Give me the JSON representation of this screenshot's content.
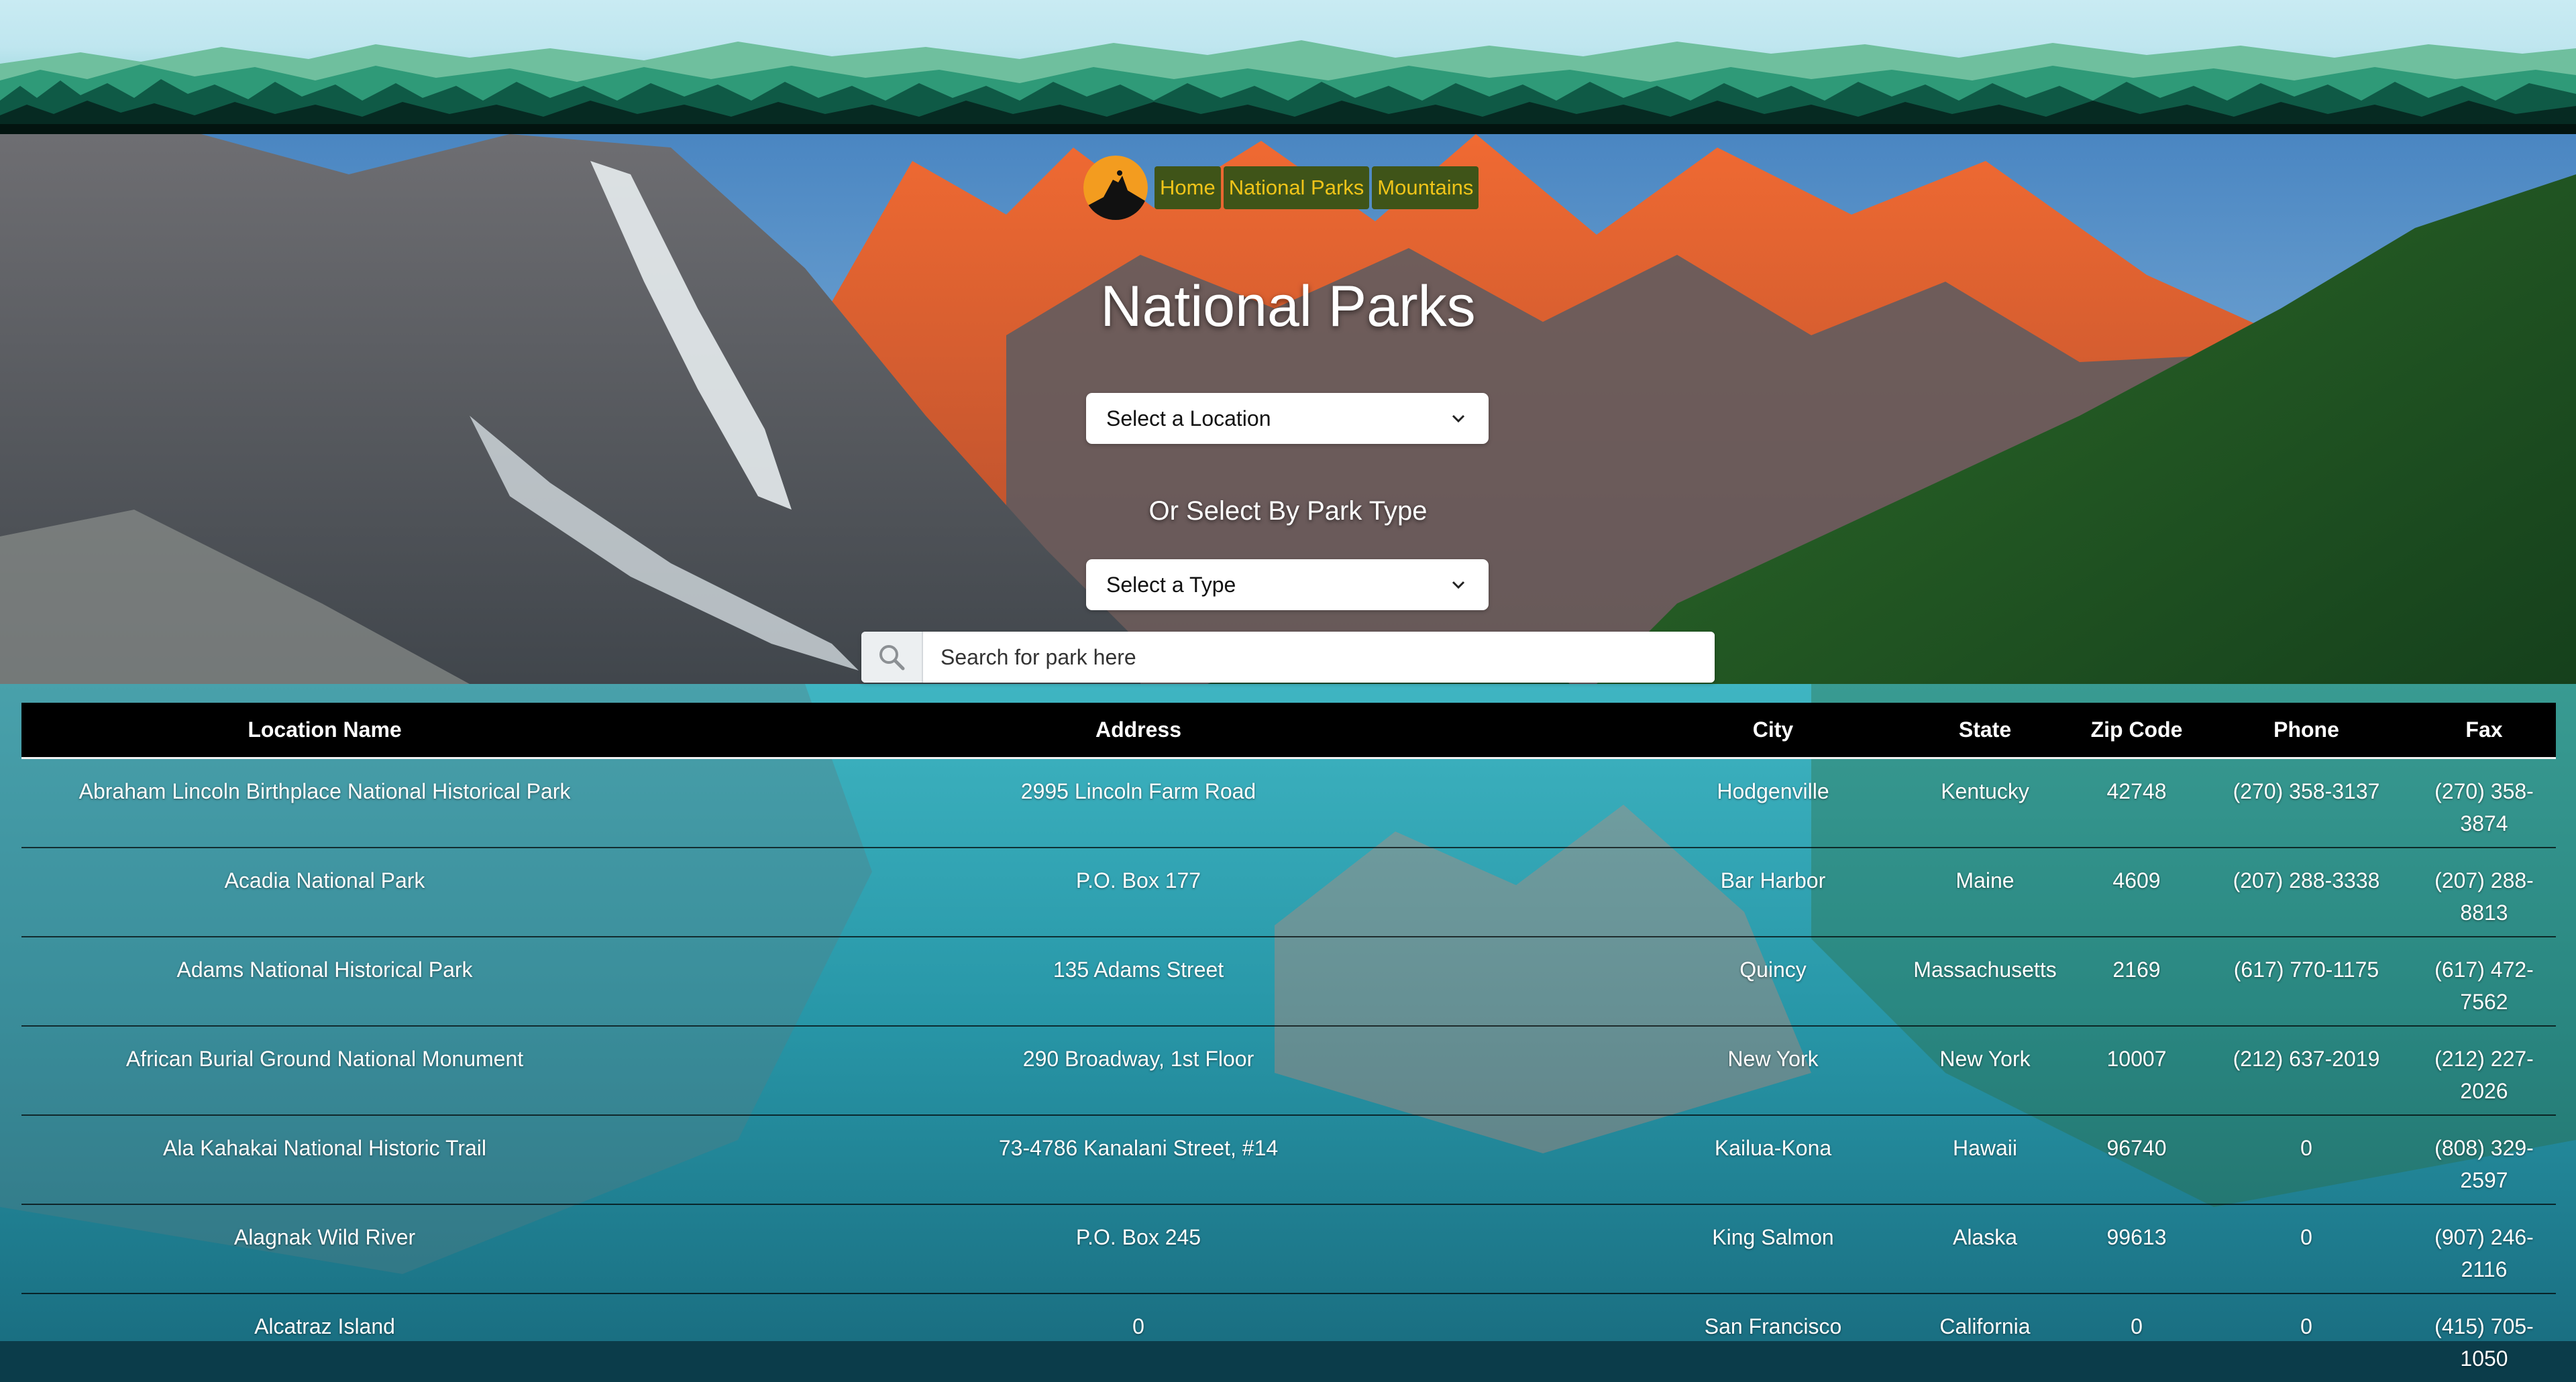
{
  "nav": {
    "logo": "mountain-logo",
    "links": [
      "Home",
      "National Parks",
      "Mountains"
    ]
  },
  "page": {
    "title": "National Parks",
    "location_select": "Select a Location",
    "or_label": "Or Select By Park Type",
    "type_select": "Select a Type",
    "search_placeholder": "Search for park here"
  },
  "table": {
    "headers": [
      "Location Name",
      "Address",
      "City",
      "State",
      "Zip Code",
      "Phone",
      "Fax"
    ],
    "rows": [
      [
        "Abraham Lincoln Birthplace National Historical Park",
        "2995 Lincoln Farm Road",
        "Hodgenville",
        "Kentucky",
        "42748",
        "(270) 358-3137",
        "(270) 358-3874"
      ],
      [
        "Acadia National Park",
        "P.O. Box 177",
        "Bar Harbor",
        "Maine",
        "4609",
        "(207) 288-3338",
        "(207) 288-8813"
      ],
      [
        "Adams National Historical Park",
        "135 Adams Street",
        "Quincy",
        "Massachusetts",
        "2169",
        "(617) 770-1175",
        "(617) 472-7562"
      ],
      [
        "African Burial Ground National Monument",
        "290 Broadway, 1st Floor",
        "New York",
        "New York",
        "10007",
        "(212) 637-2019",
        "(212) 227-2026"
      ],
      [
        "Ala Kahakai National Historic Trail",
        "73-4786 Kanalani Street, #14",
        "Kailua-Kona",
        "Hawaii",
        "96740",
        "0",
        "(808) 329-2597"
      ],
      [
        "Alagnak Wild River",
        "P.O. Box 245",
        "King Salmon",
        "Alaska",
        "99613",
        "0",
        "(907) 246-2116"
      ],
      [
        "Alcatraz Island",
        "0",
        "San Francisco",
        "California",
        "0",
        "0",
        "(415) 705-1050"
      ]
    ]
  },
  "colors": {
    "nav_bg": "#3f5418",
    "nav_text": "#f0c419",
    "table_header_bg": "#000000"
  }
}
